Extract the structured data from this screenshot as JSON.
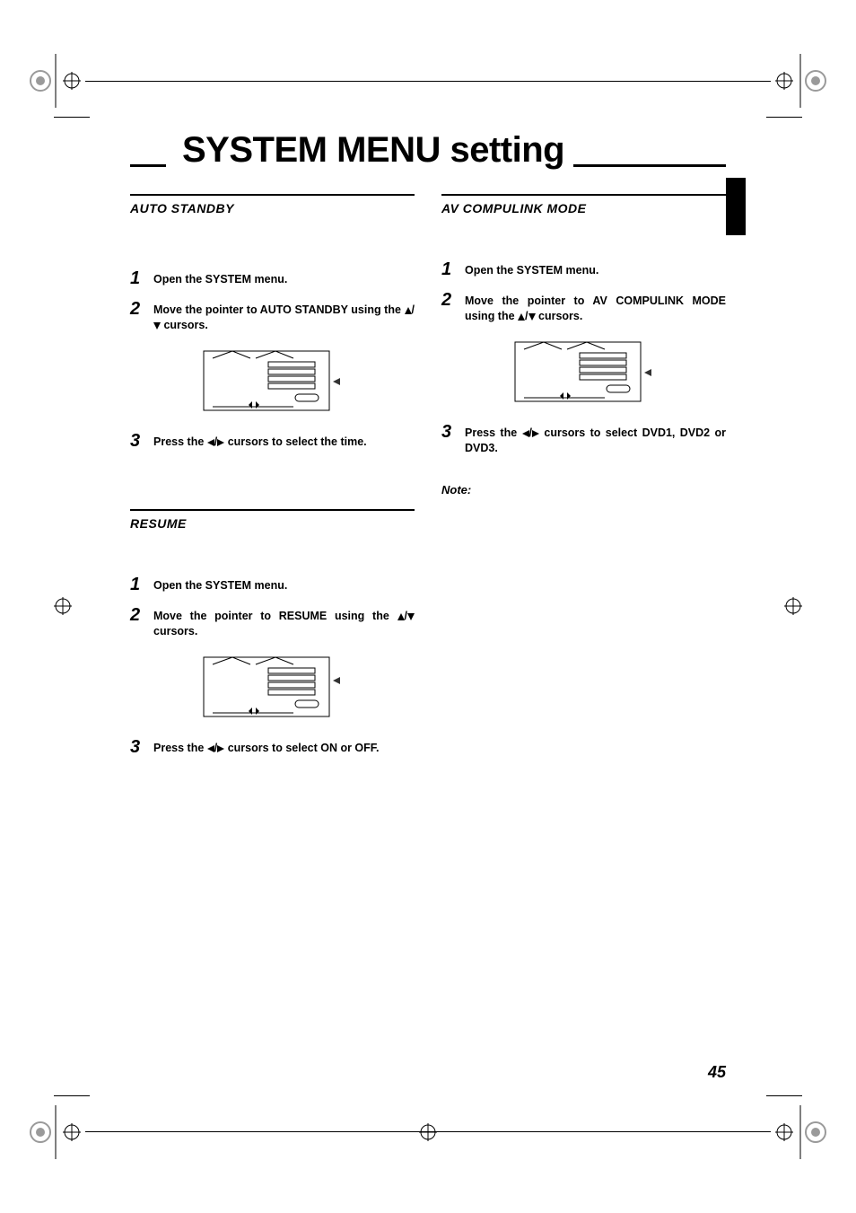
{
  "title": "SYSTEM MENU setting",
  "page_number": "45",
  "sections": {
    "auto_standby": {
      "heading": "AUTO STANDBY",
      "steps": {
        "s1": {
          "num": "1",
          "text": "Open the SYSTEM menu."
        },
        "s2": {
          "num": "2",
          "text_a": "Move the pointer to AUTO STANDBY using the ",
          "text_b": " cursors."
        },
        "s3": {
          "num": "3",
          "text_a": "Press the ",
          "text_b": " cursors to select the time."
        }
      }
    },
    "resume": {
      "heading": "RESUME",
      "steps": {
        "s1": {
          "num": "1",
          "text": "Open the SYSTEM menu."
        },
        "s2": {
          "num": "2",
          "text_a": "Move the pointer to RESUME using the ",
          "text_b": " cursors."
        },
        "s3": {
          "num": "3",
          "text_a": "Press the ",
          "text_b": " cursors to select ON or OFF."
        }
      }
    },
    "av_compulink": {
      "heading": "AV COMPULINK MODE",
      "steps": {
        "s1": {
          "num": "1",
          "text": "Open the SYSTEM menu."
        },
        "s2": {
          "num": "2",
          "text_a": "Move the pointer to AV COMPULINK MODE using the ",
          "text_b": " cursors."
        },
        "s3": {
          "num": "3",
          "text_a": "Press the ",
          "text_b": " cursors to select DVD1, DVD2 or DVD3."
        }
      },
      "note": "Note:"
    }
  }
}
